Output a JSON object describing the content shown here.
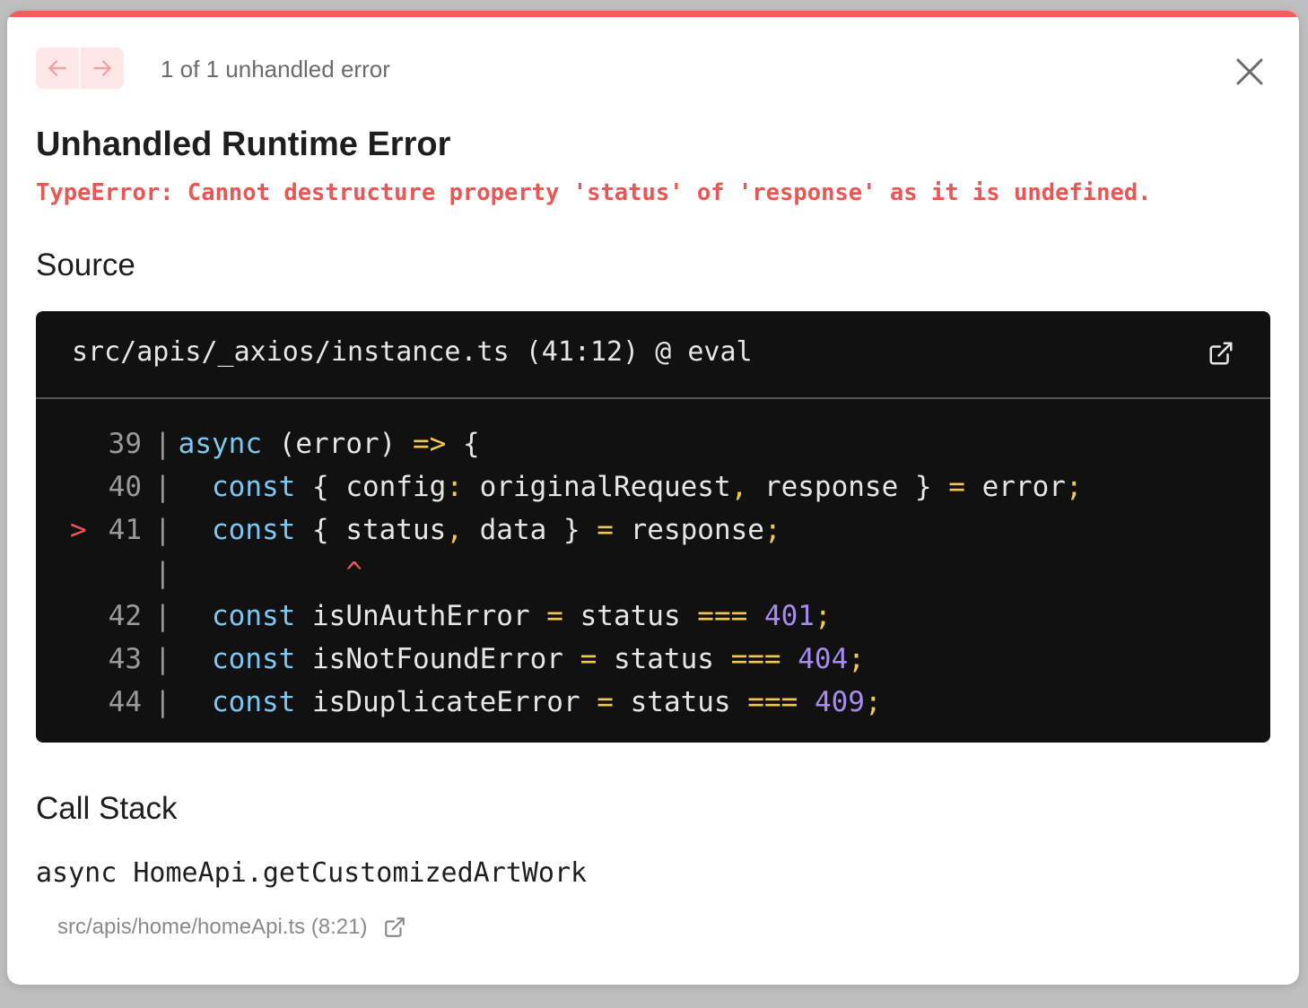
{
  "colors": {
    "accent": "#ee5f5d",
    "error_text": "#ea5654",
    "code_bg": "#111111",
    "keyword": "#7ec7f0",
    "operator": "#f2c94c",
    "number": "#a88bf0"
  },
  "header": {
    "prev_icon": "arrow-left-icon",
    "next_icon": "arrow-right-icon",
    "counter": "1 of 1 unhandled error",
    "close_icon": "close-icon"
  },
  "error": {
    "title": "Unhandled Runtime Error",
    "message": "TypeError: Cannot destructure property 'status' of 'response' as it is undefined."
  },
  "source": {
    "heading": "Source",
    "file": "src/apis/_axios/instance.ts (41:12) @ eval",
    "open_icon": "external-link-icon",
    "lines": [
      {
        "num": "39",
        "highlight": false,
        "tokens": [
          {
            "t": "async",
            "c": "kw"
          },
          {
            "t": " (error) ",
            "c": ""
          },
          {
            "t": "=>",
            "c": "op"
          },
          {
            "t": " {",
            "c": ""
          }
        ]
      },
      {
        "num": "40",
        "highlight": false,
        "tokens": [
          {
            "t": "  ",
            "c": ""
          },
          {
            "t": "const",
            "c": "kw"
          },
          {
            "t": " { config",
            "c": ""
          },
          {
            "t": ":",
            "c": "op"
          },
          {
            "t": " originalRequest",
            "c": ""
          },
          {
            "t": ",",
            "c": "op"
          },
          {
            "t": " response } ",
            "c": ""
          },
          {
            "t": "=",
            "c": "op"
          },
          {
            "t": " error",
            "c": ""
          },
          {
            "t": ";",
            "c": "op"
          }
        ]
      },
      {
        "num": "41",
        "highlight": true,
        "tokens": [
          {
            "t": "  ",
            "c": ""
          },
          {
            "t": "const",
            "c": "kw"
          },
          {
            "t": " { status",
            "c": ""
          },
          {
            "t": ",",
            "c": "op"
          },
          {
            "t": " data } ",
            "c": ""
          },
          {
            "t": "=",
            "c": "op"
          },
          {
            "t": " response",
            "c": ""
          },
          {
            "t": ";",
            "c": "op"
          }
        ]
      },
      {
        "num": "",
        "highlight": false,
        "caret": true,
        "tokens": [
          {
            "t": "          ",
            "c": ""
          },
          {
            "t": "^",
            "c": "caret"
          }
        ]
      },
      {
        "num": "42",
        "highlight": false,
        "tokens": [
          {
            "t": "  ",
            "c": ""
          },
          {
            "t": "const",
            "c": "kw"
          },
          {
            "t": " isUnAuthError ",
            "c": ""
          },
          {
            "t": "=",
            "c": "op"
          },
          {
            "t": " status ",
            "c": ""
          },
          {
            "t": "===",
            "c": "op"
          },
          {
            "t": " ",
            "c": ""
          },
          {
            "t": "401",
            "c": "num"
          },
          {
            "t": ";",
            "c": "op"
          }
        ]
      },
      {
        "num": "43",
        "highlight": false,
        "tokens": [
          {
            "t": "  ",
            "c": ""
          },
          {
            "t": "const",
            "c": "kw"
          },
          {
            "t": " isNotFoundError ",
            "c": ""
          },
          {
            "t": "=",
            "c": "op"
          },
          {
            "t": " status ",
            "c": ""
          },
          {
            "t": "===",
            "c": "op"
          },
          {
            "t": " ",
            "c": ""
          },
          {
            "t": "404",
            "c": "num"
          },
          {
            "t": ";",
            "c": "op"
          }
        ]
      },
      {
        "num": "44",
        "highlight": false,
        "tokens": [
          {
            "t": "  ",
            "c": ""
          },
          {
            "t": "const",
            "c": "kw"
          },
          {
            "t": " isDuplicateError ",
            "c": ""
          },
          {
            "t": "=",
            "c": "op"
          },
          {
            "t": " status ",
            "c": ""
          },
          {
            "t": "===",
            "c": "op"
          },
          {
            "t": " ",
            "c": ""
          },
          {
            "t": "409",
            "c": "num"
          },
          {
            "t": ";",
            "c": "op"
          }
        ]
      }
    ]
  },
  "call_stack": {
    "heading": "Call Stack",
    "frames": [
      {
        "fn": "async HomeApi.getCustomizedArtWork",
        "location": "src/apis/home/homeApi.ts (8:21)",
        "open_icon": "external-link-icon"
      }
    ]
  }
}
